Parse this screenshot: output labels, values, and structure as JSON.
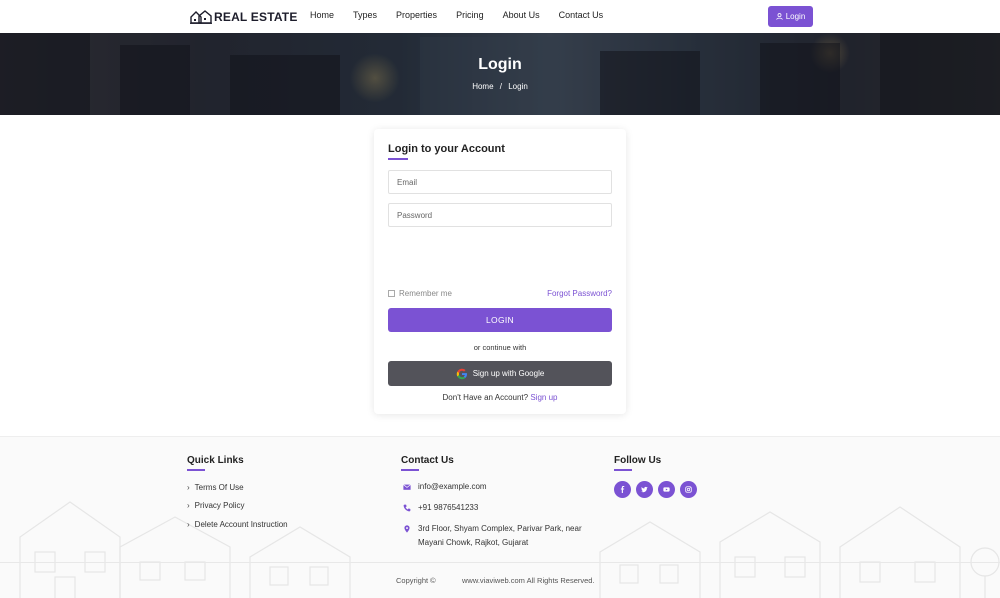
{
  "brand": {
    "name": "REAL ESTATE"
  },
  "nav": {
    "items": [
      "Home",
      "Types",
      "Properties",
      "Pricing",
      "About Us",
      "Contact Us"
    ],
    "login_label": "Login"
  },
  "hero": {
    "title": "Login",
    "breadcrumb": {
      "home": "Home",
      "separator": "/",
      "current": "Login"
    }
  },
  "login_form": {
    "title": "Login to your Account",
    "email_placeholder": "Email",
    "password_placeholder": "Password",
    "remember_label": "Remember me",
    "forgot_label": "Forgot Password?",
    "submit_label": "LOGIN",
    "divider_text": "or continue with",
    "google_label": "Sign up with Google",
    "no_account_text": "Don't Have an Account?",
    "signup_label": "Sign up"
  },
  "footer": {
    "quick_links": {
      "title": "Quick Links",
      "items": [
        "Terms Of Use",
        "Privacy Policy",
        "Delete Account Instruction"
      ]
    },
    "contact": {
      "title": "Contact Us",
      "email": "info@example.com",
      "phone": "+91 9876541233",
      "address_line1": "3rd Floor, Shyam Complex, Parivar Park, near",
      "address_line2": "Mayani Chowk, Rajkot, Gujarat"
    },
    "follow": {
      "title": "Follow Us",
      "icons": [
        "facebook-icon",
        "twitter-icon",
        "youtube-icon",
        "instagram-icon"
      ]
    },
    "copyright_label": "Copyright ©",
    "copyright_text": "www.viaviweb.com All Rights Reserved."
  },
  "colors": {
    "accent": "#7b52d3",
    "google_button": "#53535a"
  }
}
